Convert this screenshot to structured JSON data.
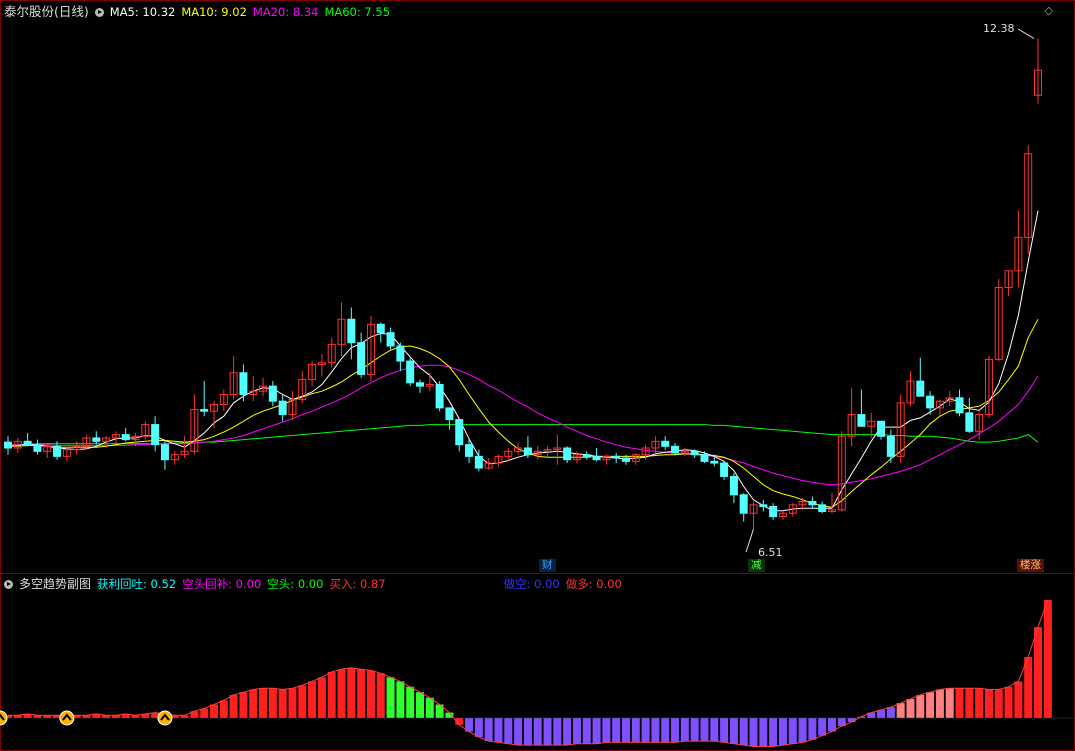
{
  "main_panel": {
    "title": "泰尔股份(日线)",
    "ma_items": [
      {
        "label": "MA5:",
        "value": "10.32",
        "color": "#ffffff"
      },
      {
        "label": "MA10:",
        "value": "9.02",
        "color": "#ffff00"
      },
      {
        "label": "MA20:",
        "value": "8.34",
        "color": "#ff00ff"
      },
      {
        "label": "MA60:",
        "value": "7.55",
        "color": "#00ff00"
      }
    ],
    "high_label": "12.38",
    "low_label": "6.51",
    "markers": [
      {
        "text": "财",
        "color": "#40a0ff",
        "bg": "#0a2040"
      },
      {
        "text": "减",
        "color": "#40ff40",
        "bg": "#103010"
      },
      {
        "text": "楼涨",
        "color": "#ffcc66",
        "bg": "#5a1010"
      }
    ],
    "corner_icon": "diamond-icon"
  },
  "sub_panel": {
    "title": "多空趋势副图",
    "indicators": [
      {
        "label": "获利回吐:",
        "value": "0.52",
        "color": "#00ffff"
      },
      {
        "label": "空头回补:",
        "value": "0.00",
        "color": "#ff00ff"
      },
      {
        "label": "空头:",
        "value": "0.00",
        "color": "#00ff00"
      },
      {
        "label": "买入:",
        "value": "0.87",
        "color": "#ff3333"
      },
      {
        "label": "做空:",
        "value": "0.00",
        "color": "#3333ff"
      },
      {
        "label": "做多:",
        "value": "0.00",
        "color": "#ff3333"
      }
    ],
    "signal_icon": "up-arrow-circle-icon"
  },
  "colors": {
    "up": "#ff3232",
    "down": "#54ffff",
    "ma5": "#ffffff",
    "ma10": "#ffff00",
    "ma20": "#ff00ff",
    "ma60": "#00ff00",
    "border": "#7a0000",
    "hist_red": "#ff2020",
    "hist_blue": "#8050ff",
    "hist_green": "#30ff30",
    "hist_pink": "#ff8080"
  },
  "chart_data": {
    "type": "candlestick",
    "ylim": [
      6.2,
      12.6
    ],
    "candles": [
      [
        7.55,
        7.62,
        7.4,
        7.48
      ],
      [
        7.48,
        7.6,
        7.42,
        7.56
      ],
      [
        7.56,
        7.66,
        7.5,
        7.52
      ],
      [
        7.52,
        7.58,
        7.4,
        7.44
      ],
      [
        7.44,
        7.52,
        7.36,
        7.5
      ],
      [
        7.5,
        7.56,
        7.34,
        7.38
      ],
      [
        7.38,
        7.5,
        7.32,
        7.46
      ],
      [
        7.46,
        7.56,
        7.4,
        7.5
      ],
      [
        7.5,
        7.64,
        7.46,
        7.6
      ],
      [
        7.6,
        7.68,
        7.52,
        7.56
      ],
      [
        7.56,
        7.62,
        7.48,
        7.6
      ],
      [
        7.6,
        7.68,
        7.54,
        7.64
      ],
      [
        7.64,
        7.72,
        7.56,
        7.58
      ],
      [
        7.58,
        7.66,
        7.5,
        7.62
      ],
      [
        7.62,
        7.8,
        7.58,
        7.76
      ],
      [
        7.76,
        7.86,
        7.44,
        7.52
      ],
      [
        7.52,
        7.58,
        7.22,
        7.34
      ],
      [
        7.34,
        7.44,
        7.28,
        7.4
      ],
      [
        7.4,
        7.62,
        7.36,
        7.44
      ],
      [
        7.44,
        8.12,
        7.4,
        7.94
      ],
      [
        7.94,
        8.28,
        7.86,
        7.92
      ],
      [
        7.92,
        8.04,
        7.72,
        8.0
      ],
      [
        8.0,
        8.18,
        7.92,
        8.12
      ],
      [
        8.12,
        8.58,
        8.06,
        8.38
      ],
      [
        8.38,
        8.48,
        8.04,
        8.12
      ],
      [
        8.12,
        8.34,
        8.04,
        8.16
      ],
      [
        8.16,
        8.32,
        8.1,
        8.22
      ],
      [
        8.22,
        8.28,
        7.98,
        8.04
      ],
      [
        8.04,
        8.12,
        7.8,
        7.88
      ],
      [
        7.88,
        8.16,
        7.82,
        8.06
      ],
      [
        8.06,
        8.4,
        8.02,
        8.3
      ],
      [
        8.3,
        8.52,
        8.22,
        8.48
      ],
      [
        8.48,
        8.6,
        8.34,
        8.5
      ],
      [
        8.5,
        8.8,
        8.44,
        8.72
      ],
      [
        8.72,
        9.22,
        8.58,
        9.02
      ],
      [
        9.02,
        9.16,
        8.54,
        8.74
      ],
      [
        8.74,
        8.86,
        8.32,
        8.36
      ],
      [
        8.36,
        9.06,
        8.28,
        8.96
      ],
      [
        8.96,
        8.98,
        8.74,
        8.86
      ],
      [
        8.86,
        8.92,
        8.66,
        8.7
      ],
      [
        8.7,
        8.74,
        8.4,
        8.52
      ],
      [
        8.52,
        8.56,
        8.22,
        8.26
      ],
      [
        8.26,
        8.3,
        8.14,
        8.22
      ],
      [
        8.22,
        8.38,
        8.16,
        8.24
      ],
      [
        8.24,
        8.28,
        7.92,
        7.96
      ],
      [
        7.96,
        7.96,
        7.7,
        7.82
      ],
      [
        7.82,
        7.82,
        7.44,
        7.52
      ],
      [
        7.52,
        7.6,
        7.3,
        7.38
      ],
      [
        7.38,
        7.46,
        7.2,
        7.24
      ],
      [
        7.24,
        7.36,
        7.22,
        7.3
      ],
      [
        7.3,
        7.4,
        7.26,
        7.38
      ],
      [
        7.38,
        7.48,
        7.32,
        7.44
      ],
      [
        7.44,
        7.54,
        7.4,
        7.48
      ],
      [
        7.48,
        7.62,
        7.36,
        7.4
      ],
      [
        7.4,
        7.5,
        7.34,
        7.44
      ],
      [
        7.44,
        7.5,
        7.38,
        7.46
      ],
      [
        7.46,
        7.64,
        7.28,
        7.48
      ],
      [
        7.48,
        7.5,
        7.3,
        7.34
      ],
      [
        7.34,
        7.44,
        7.3,
        7.4
      ],
      [
        7.4,
        7.44,
        7.34,
        7.38
      ],
      [
        7.38,
        7.48,
        7.32,
        7.34
      ],
      [
        7.34,
        7.4,
        7.28,
        7.38
      ],
      [
        7.38,
        7.42,
        7.3,
        7.36
      ],
      [
        7.36,
        7.4,
        7.28,
        7.32
      ],
      [
        7.32,
        7.42,
        7.28,
        7.4
      ],
      [
        7.4,
        7.52,
        7.34,
        7.48
      ],
      [
        7.48,
        7.62,
        7.42,
        7.56
      ],
      [
        7.56,
        7.62,
        7.46,
        7.5
      ],
      [
        7.5,
        7.54,
        7.4,
        7.42
      ],
      [
        7.42,
        7.48,
        7.38,
        7.44
      ],
      [
        7.44,
        7.46,
        7.36,
        7.4
      ],
      [
        7.4,
        7.44,
        7.3,
        7.32
      ],
      [
        7.32,
        7.4,
        7.26,
        7.3
      ],
      [
        7.3,
        7.32,
        7.1,
        7.14
      ],
      [
        7.14,
        7.18,
        6.82,
        6.92
      ],
      [
        6.92,
        6.94,
        6.6,
        6.7
      ],
      [
        6.7,
        6.84,
        6.51,
        6.8
      ],
      [
        6.8,
        6.86,
        6.72,
        6.78
      ],
      [
        6.78,
        6.82,
        6.62,
        6.66
      ],
      [
        6.66,
        6.72,
        6.62,
        6.7
      ],
      [
        6.7,
        6.82,
        6.66,
        6.8
      ],
      [
        6.8,
        6.88,
        6.74,
        6.84
      ],
      [
        6.84,
        6.9,
        6.76,
        6.8
      ],
      [
        6.8,
        6.84,
        6.7,
        6.72
      ],
      [
        6.72,
        6.94,
        6.7,
        6.74
      ],
      [
        6.74,
        7.68,
        6.72,
        7.62
      ],
      [
        7.62,
        8.2,
        7.5,
        7.88
      ],
      [
        7.88,
        8.18,
        7.76,
        7.74
      ],
      [
        7.74,
        7.9,
        7.6,
        7.8
      ],
      [
        7.8,
        7.8,
        7.58,
        7.62
      ],
      [
        7.62,
        7.7,
        7.3,
        7.38
      ],
      [
        7.38,
        8.12,
        7.3,
        8.02
      ],
      [
        8.02,
        8.4,
        7.98,
        8.28
      ],
      [
        8.28,
        8.56,
        8.16,
        8.1
      ],
      [
        8.1,
        8.16,
        7.88,
        7.96
      ],
      [
        7.96,
        8.06,
        7.86,
        8.04
      ],
      [
        8.04,
        8.16,
        7.98,
        8.08
      ],
      [
        8.08,
        8.18,
        7.86,
        7.9
      ],
      [
        7.9,
        8.08,
        7.66,
        7.68
      ],
      [
        7.68,
        7.92,
        7.58,
        7.88
      ],
      [
        7.88,
        8.58,
        7.84,
        8.54
      ],
      [
        8.54,
        9.5,
        8.52,
        9.4
      ],
      [
        9.4,
        9.6,
        9.3,
        9.6
      ],
      [
        9.6,
        10.32,
        9.4,
        10.0
      ],
      [
        10.0,
        11.1,
        9.8,
        11.0
      ],
      [
        11.7,
        12.38,
        11.6,
        12.0
      ]
    ],
    "ma5": [
      7.5,
      7.51,
      7.53,
      7.52,
      7.5,
      7.48,
      7.47,
      7.46,
      7.47,
      7.5,
      7.55,
      7.59,
      7.6,
      7.6,
      7.63,
      7.62,
      7.57,
      7.53,
      7.49,
      7.57,
      7.66,
      7.78,
      7.86,
      8.02,
      8.1,
      8.16,
      8.2,
      8.19,
      8.12,
      8.06,
      8.1,
      8.15,
      8.24,
      8.39,
      8.55,
      8.68,
      8.73,
      8.81,
      8.85,
      8.84,
      8.7,
      8.57,
      8.44,
      8.35,
      8.21,
      8.04,
      7.83,
      7.59,
      7.38,
      7.29,
      7.3,
      7.33,
      7.37,
      7.4,
      7.42,
      7.43,
      7.44,
      7.43,
      7.41,
      7.4,
      7.38,
      7.37,
      7.36,
      7.35,
      7.36,
      7.37,
      7.41,
      7.43,
      7.44,
      7.46,
      7.45,
      7.42,
      7.38,
      7.32,
      7.21,
      7.02,
      6.86,
      6.79,
      6.73,
      6.73,
      6.75,
      6.76,
      6.76,
      6.76,
      6.76,
      6.98,
      7.17,
      7.36,
      7.56,
      7.73,
      7.73,
      7.73,
      7.81,
      7.84,
      7.91,
      7.98,
      8.07,
      8.03,
      7.95,
      7.93,
      8.03,
      8.25,
      8.61,
      9.07,
      9.71,
      10.32
    ],
    "ma10": [
      7.5,
      7.5,
      7.51,
      7.51,
      7.5,
      7.49,
      7.49,
      7.49,
      7.49,
      7.49,
      7.5,
      7.52,
      7.54,
      7.55,
      7.56,
      7.57,
      7.57,
      7.56,
      7.55,
      7.56,
      7.58,
      7.62,
      7.67,
      7.73,
      7.8,
      7.87,
      7.92,
      7.96,
      8.0,
      8.05,
      8.09,
      8.13,
      8.16,
      8.21,
      8.27,
      8.35,
      8.42,
      8.5,
      8.58,
      8.65,
      8.69,
      8.7,
      8.67,
      8.62,
      8.55,
      8.45,
      8.3,
      8.12,
      7.95,
      7.79,
      7.67,
      7.56,
      7.47,
      7.42,
      7.38,
      7.37,
      7.37,
      7.37,
      7.37,
      7.37,
      7.38,
      7.38,
      7.38,
      7.38,
      7.38,
      7.38,
      7.39,
      7.4,
      7.4,
      7.41,
      7.41,
      7.4,
      7.39,
      7.37,
      7.32,
      7.24,
      7.14,
      7.04,
      6.97,
      6.93,
      6.9,
      6.86,
      6.82,
      6.79,
      6.77,
      6.85,
      6.96,
      7.06,
      7.16,
      7.25,
      7.35,
      7.44,
      7.54,
      7.64,
      7.77,
      7.86,
      7.92,
      7.94,
      7.96,
      7.98,
      8.05,
      8.15,
      8.3,
      8.46,
      8.8,
      9.02
    ],
    "ma20": [
      7.52,
      7.52,
      7.52,
      7.52,
      7.52,
      7.51,
      7.51,
      7.51,
      7.51,
      7.51,
      7.51,
      7.51,
      7.51,
      7.52,
      7.52,
      7.53,
      7.53,
      7.53,
      7.53,
      7.54,
      7.55,
      7.56,
      7.58,
      7.6,
      7.63,
      7.67,
      7.71,
      7.75,
      7.79,
      7.83,
      7.88,
      7.92,
      7.97,
      8.02,
      8.07,
      8.13,
      8.2,
      8.26,
      8.32,
      8.37,
      8.41,
      8.44,
      8.46,
      8.47,
      8.47,
      8.45,
      8.41,
      8.36,
      8.3,
      8.23,
      8.17,
      8.1,
      8.03,
      7.97,
      7.9,
      7.84,
      7.79,
      7.73,
      7.68,
      7.63,
      7.59,
      7.55,
      7.52,
      7.49,
      7.47,
      7.45,
      7.44,
      7.43,
      7.42,
      7.41,
      7.4,
      7.39,
      7.38,
      7.36,
      7.33,
      7.3,
      7.26,
      7.22,
      7.18,
      7.15,
      7.12,
      7.09,
      7.07,
      7.05,
      7.04,
      7.05,
      7.07,
      7.09,
      7.11,
      7.14,
      7.17,
      7.2,
      7.24,
      7.28,
      7.34,
      7.4,
      7.46,
      7.52,
      7.58,
      7.65,
      7.72,
      7.8,
      7.9,
      8.0,
      8.16,
      8.34
    ],
    "ma60": [
      7.52,
      7.52,
      7.52,
      7.53,
      7.53,
      7.53,
      7.53,
      7.53,
      7.53,
      7.53,
      7.53,
      7.53,
      7.53,
      7.53,
      7.53,
      7.53,
      7.53,
      7.54,
      7.54,
      7.54,
      7.55,
      7.55,
      7.56,
      7.57,
      7.58,
      7.59,
      7.6,
      7.61,
      7.62,
      7.63,
      7.64,
      7.65,
      7.66,
      7.67,
      7.68,
      7.69,
      7.7,
      7.71,
      7.72,
      7.73,
      7.74,
      7.75,
      7.75,
      7.76,
      7.76,
      7.76,
      7.76,
      7.76,
      7.76,
      7.76,
      7.76,
      7.76,
      7.76,
      7.76,
      7.76,
      7.76,
      7.76,
      7.76,
      7.76,
      7.76,
      7.76,
      7.76,
      7.76,
      7.76,
      7.76,
      7.76,
      7.76,
      7.76,
      7.76,
      7.76,
      7.76,
      7.76,
      7.75,
      7.75,
      7.74,
      7.73,
      7.72,
      7.71,
      7.7,
      7.69,
      7.68,
      7.67,
      7.66,
      7.65,
      7.64,
      7.64,
      7.64,
      7.64,
      7.64,
      7.64,
      7.63,
      7.63,
      7.62,
      7.62,
      7.62,
      7.61,
      7.6,
      7.58,
      7.56,
      7.55,
      7.55,
      7.56,
      7.58,
      7.6,
      7.64,
      7.55
    ],
    "histogram": [
      0.02,
      0.02,
      0.03,
      0.02,
      0.02,
      0.02,
      0.02,
      0.02,
      0.02,
      0.03,
      0.02,
      0.02,
      0.03,
      0.02,
      0.03,
      0.04,
      0.03,
      0.02,
      0.02,
      0.05,
      0.07,
      0.1,
      0.13,
      0.17,
      0.19,
      0.21,
      0.22,
      0.22,
      0.21,
      0.22,
      0.24,
      0.27,
      0.3,
      0.34,
      0.36,
      0.37,
      0.36,
      0.35,
      0.33,
      0.3,
      0.27,
      0.23,
      0.19,
      0.15,
      0.1,
      0.04,
      -0.05,
      -0.1,
      -0.14,
      -0.17,
      -0.18,
      -0.19,
      -0.2,
      -0.2,
      -0.2,
      -0.2,
      -0.2,
      -0.2,
      -0.19,
      -0.19,
      -0.19,
      -0.18,
      -0.18,
      -0.18,
      -0.18,
      -0.18,
      -0.18,
      -0.18,
      -0.18,
      -0.17,
      -0.17,
      -0.17,
      -0.17,
      -0.18,
      -0.19,
      -0.2,
      -0.21,
      -0.21,
      -0.21,
      -0.2,
      -0.19,
      -0.18,
      -0.16,
      -0.13,
      -0.1,
      -0.06,
      -0.03,
      0.01,
      0.04,
      0.06,
      0.08,
      0.11,
      0.14,
      0.17,
      0.19,
      0.21,
      0.22,
      0.22,
      0.22,
      0.22,
      0.21,
      0.21,
      0.23,
      0.27,
      0.45,
      0.67,
      0.87
    ],
    "hist_colors": "rrrrrrrrrrrrrrrrrrrrrrrrrrrrrrrrrrrrrrrgggggggrbbbbbbbbbbbbbbbbbbbbbbbbbbbbbbbbbbbbbbbbbbbbpppppprrrrrrrrrrrrrrrrrrrrr",
    "signals": [
      6,
      16,
      143
    ]
  }
}
